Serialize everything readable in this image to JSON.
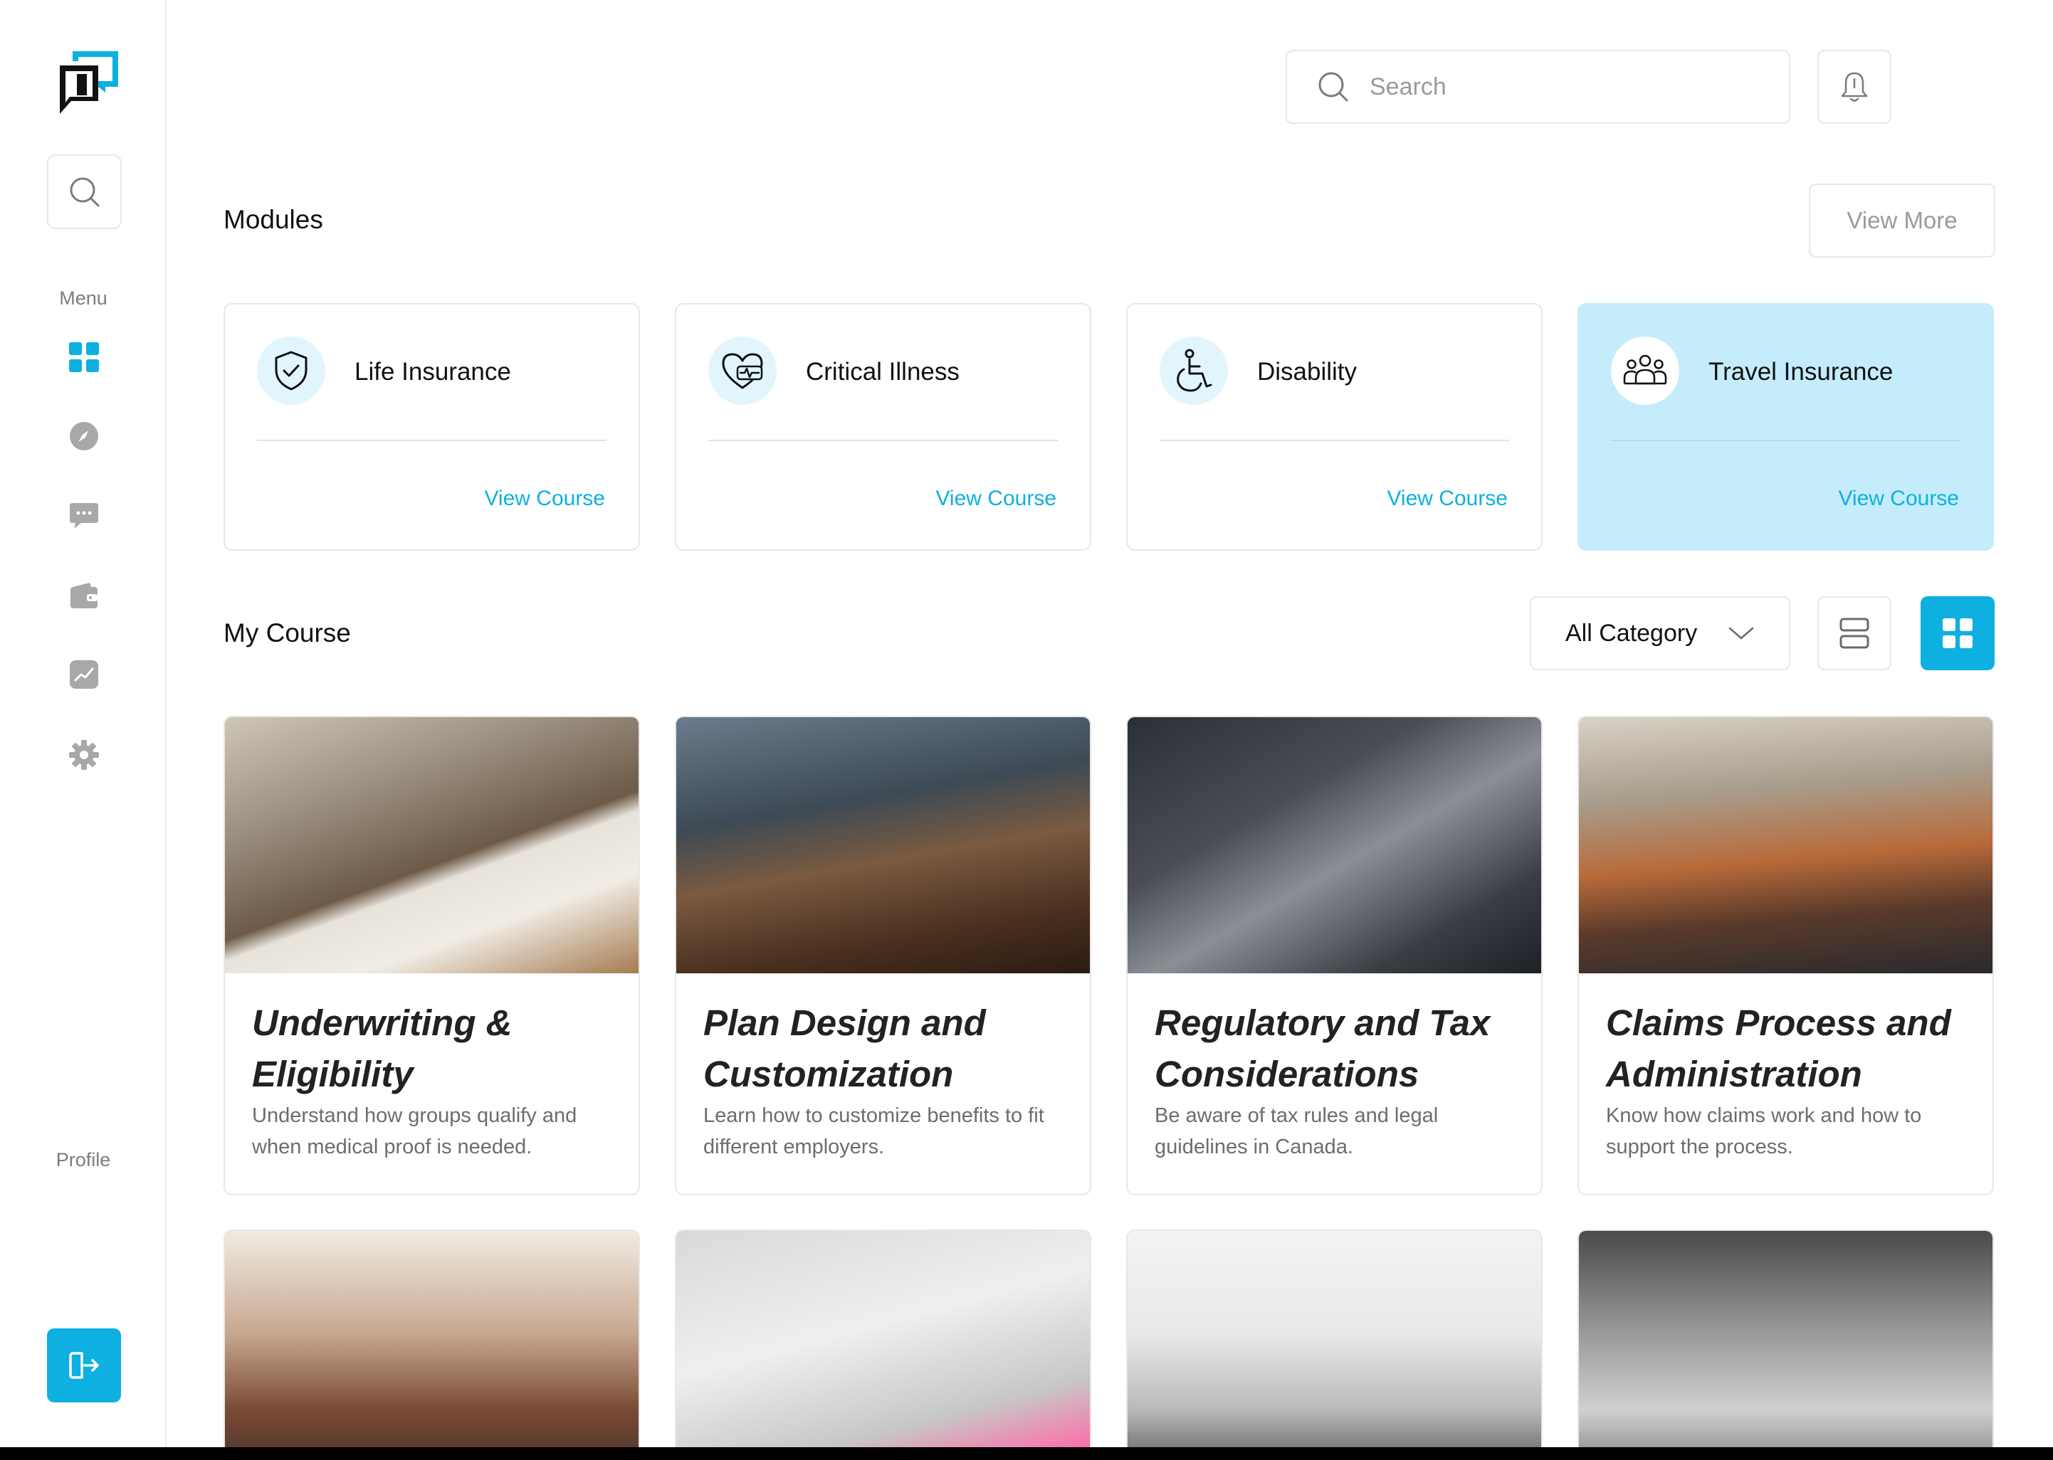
{
  "colors": {
    "accent": "#0db0e0",
    "active_module_bg": "#c4ecfb"
  },
  "sidebar": {
    "logo": "brand-logo",
    "menu_label": "Menu",
    "items": [
      {
        "icon": "dashboard-grid-icon",
        "active": true
      },
      {
        "icon": "compass-icon",
        "active": false
      },
      {
        "icon": "chat-icon",
        "active": false
      },
      {
        "icon": "wallet-icon",
        "active": false
      },
      {
        "icon": "analytics-icon",
        "active": false
      },
      {
        "icon": "settings-gear-icon",
        "active": false
      }
    ],
    "profile_label": "Profile",
    "logout_icon": "logout-icon"
  },
  "header": {
    "search_placeholder": "Search"
  },
  "modules": {
    "title": "Modules",
    "view_more": "View More",
    "items": [
      {
        "name": "Life Insurance",
        "link": "View Course",
        "icon": "shield-check-icon",
        "active": false
      },
      {
        "name": "Critical Illness",
        "link": "View Course",
        "icon": "heart-pulse-icon",
        "active": false
      },
      {
        "name": "Disability",
        "link": "View Course",
        "icon": "wheelchair-icon",
        "active": false
      },
      {
        "name": "Travel Insurance",
        "link": "View Course",
        "icon": "group-people-icon",
        "active": true
      }
    ]
  },
  "my_course": {
    "title": "My Course",
    "category_filter": "All Category",
    "courses": [
      {
        "title": "Underwriting & Eligibility",
        "description": "Understand how groups qualify and when medical proof is needed."
      },
      {
        "title": "Plan Design and Customization",
        "description": "Learn how to customize benefits to fit different employers."
      },
      {
        "title": "Regulatory and Tax Considerations",
        "description": "Be aware of tax rules and legal guidelines in Canada."
      },
      {
        "title": "Claims Process and Administration",
        "description": "Know how claims work and how to support the process."
      }
    ]
  }
}
